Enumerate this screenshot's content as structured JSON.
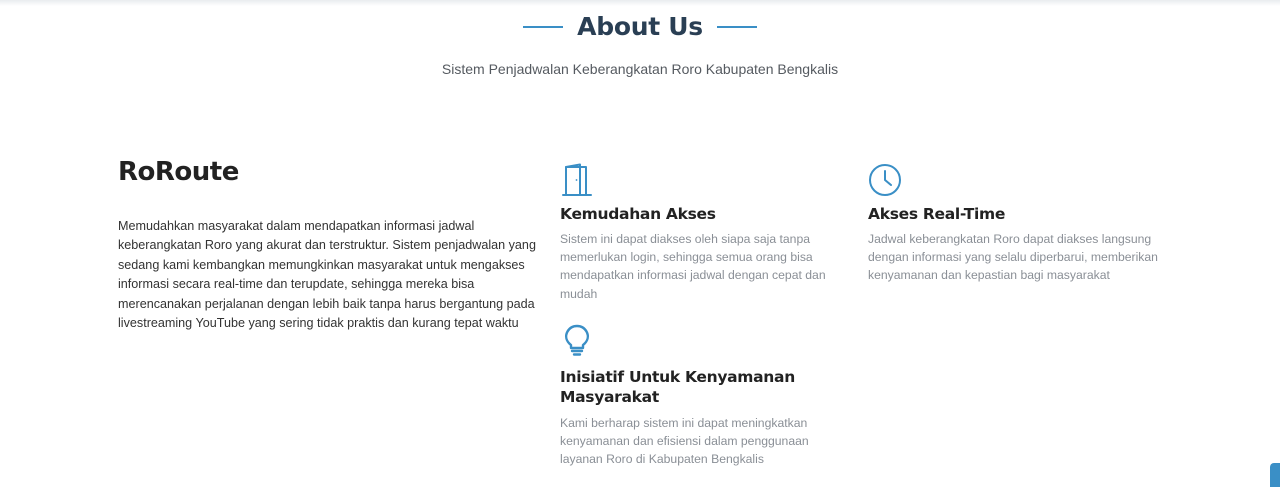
{
  "section": {
    "title": "About Us",
    "subtitle": "Sistem Penjadwalan Keberangkatan Roro Kabupaten Bengkalis"
  },
  "about": {
    "brand": "RoRoute",
    "description": "Memudahkan masyarakat dalam mendapatkan informasi jadwal keberangkatan Roro yang akurat dan terstruktur. Sistem penjadwalan yang sedang kami kembangkan memungkinkan masyarakat untuk mengakses informasi secara real-time dan terupdate, sehingga mereka bisa merencanakan perjalanan dengan lebih baik tanpa harus bergantung pada livestreaming YouTube yang sering tidak praktis dan kurang tepat waktu"
  },
  "features": [
    {
      "icon": "door-icon",
      "title": "Kemudahan Akses",
      "description": "Sistem ini dapat diakses oleh siapa saja tanpa memerlukan login, sehingga semua orang bisa mendapatkan informasi jadwal dengan cepat dan mudah"
    },
    {
      "icon": "clock-icon",
      "title": "Akses Real-Time",
      "description": "Jadwal keberangkatan Roro dapat diakses langsung dengan informasi yang selalu diperbarui, memberikan kenyamanan dan kepastian bagi masyarakat"
    },
    {
      "icon": "lightbulb-icon",
      "title": "Inisiatif Untuk Kenyamanan Masyarakat",
      "description": "Kami berharap sistem ini dapat meningkatkan kenyamanan dan efisiensi dalam penggunaan layanan Roro di Kabupaten Bengkalis"
    }
  ],
  "colors": {
    "accent": "#3a8fc6",
    "heading": "#2a3f54",
    "muted_text": "#8a8f96"
  }
}
